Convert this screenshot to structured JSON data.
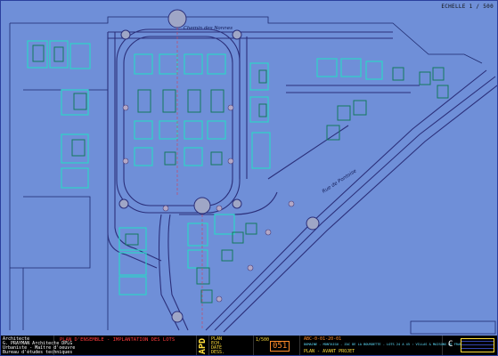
{
  "scale_label": "ECHELLE 1 / 500",
  "colors": {
    "background": "#6f8fd8",
    "roads": "#2b2f7a",
    "lots": "#2dd4c8",
    "buildings": "#1a8f6a",
    "title_block": "#000000",
    "title_text": "#ff3b3b",
    "meta_text": "#ffde3b"
  },
  "street_names": {
    "top": "Chemin des Nonnes",
    "diagonal": "Rue de Pontoise"
  },
  "title_block": {
    "company_lines": [
      "Architecte",
      "G. PRAYMAN Architecte DPLG",
      "Urbaniste - Maître d'oeuvre",
      "Bureau d'études techniques"
    ],
    "drawing_title": "PLAN D'ENSEMBLE - IMPLANTATION DES LOTS",
    "apd_label": "APD",
    "phase_lines": [
      "PLAN",
      "ECH.",
      "DATE",
      "DESS."
    ],
    "project_line": "DOMAINE - MONTAIGU - ZAC DE LA BOURDETTE - LOTS 24 A 45 : VILLAS & MAISONS DE FRANCE",
    "sub_line": "PLAN - AVANT PROJET",
    "sheet_number": "051",
    "scale_value": "1/500",
    "revision": "C",
    "ref_code": "ABC-0-01-20-01"
  }
}
